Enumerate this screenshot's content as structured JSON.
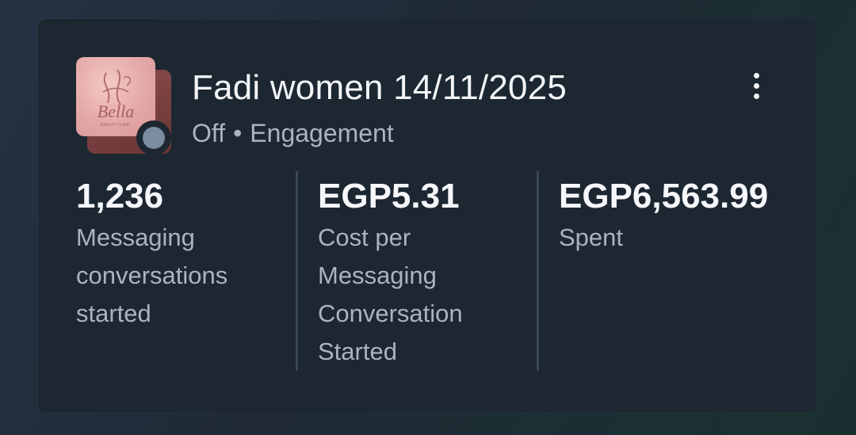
{
  "campaign": {
    "title": "Fadi women 14/11/2025",
    "status": "Off",
    "separator": "•",
    "objective": "Engagement",
    "thumbnail_text": "Bella",
    "thumbnail_subtext": "BEAUTY CLINIC",
    "status_color": "#7a8c9f"
  },
  "metrics": [
    {
      "value": "1,236",
      "label": "Messaging conversations started"
    },
    {
      "value": "EGP5.31",
      "label": "Cost per Messaging Conversation Started"
    },
    {
      "value": "EGP6,563.99",
      "label": "Spent"
    }
  ],
  "icons": {
    "menu": "more-vertical-icon"
  }
}
